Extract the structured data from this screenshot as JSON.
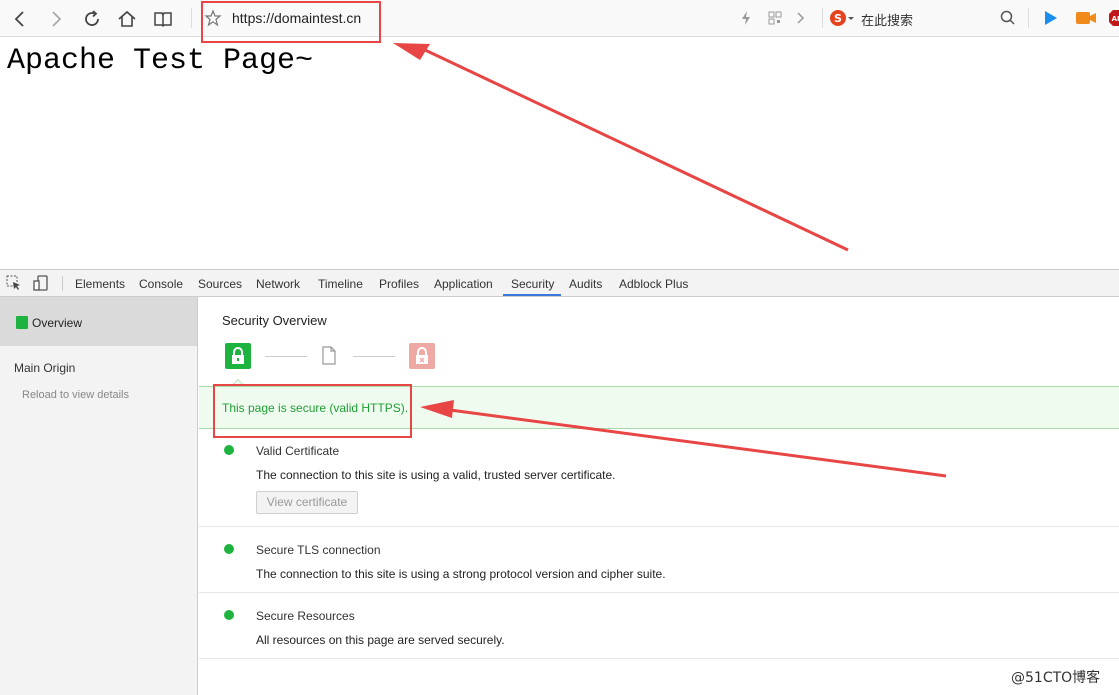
{
  "browser": {
    "url": "https://domaintest.cn",
    "search_placeholder": "在此搜索"
  },
  "page": {
    "heading": "Apache Test Page~"
  },
  "devtools": {
    "tabs": [
      "Elements",
      "Console",
      "Sources",
      "Network",
      "Timeline",
      "Profiles",
      "Application",
      "Security",
      "Audits",
      "Adblock Plus"
    ],
    "active_tab": "Security",
    "sidebar": {
      "overview": "Overview",
      "main_origin": "Main Origin",
      "reload_hint": "Reload to view details"
    },
    "overview": {
      "title": "Security Overview",
      "banner": "This page is secure (valid HTTPS).",
      "items": [
        {
          "title": "Valid Certificate",
          "desc": "The connection to this site is using a valid, trusted server certificate.",
          "button": "View certificate"
        },
        {
          "title": "Secure TLS connection",
          "desc": "The connection to this site is using a strong protocol version and cipher suite."
        },
        {
          "title": "Secure Resources",
          "desc": "All resources on this page are served securely."
        }
      ]
    }
  },
  "watermark": "@51CTO博客",
  "colors": {
    "secure_green": "#1db33e",
    "annotation_red": "#e84545",
    "tab_accent": "#3879d9"
  }
}
